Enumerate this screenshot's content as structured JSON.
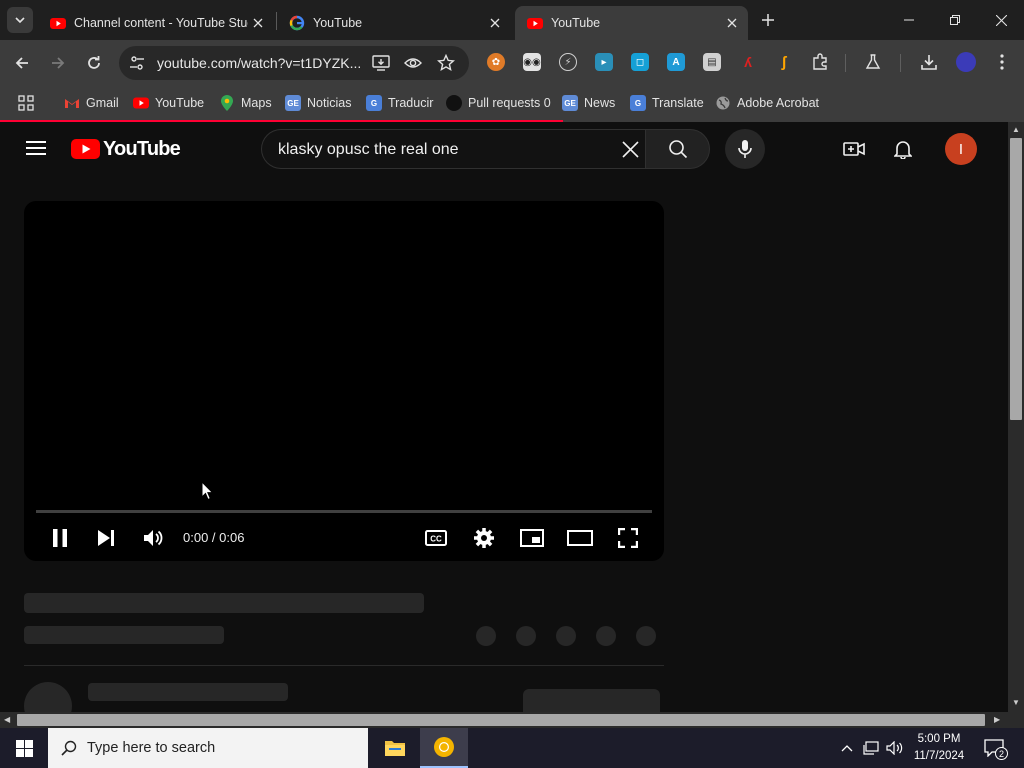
{
  "browser": {
    "tabs": [
      {
        "title": "Channel content - YouTube Studio",
        "icon": "youtube-favicon",
        "active": false
      },
      {
        "title": "YouTube",
        "icon": "google-favicon",
        "active": false
      },
      {
        "title": "YouTube",
        "icon": "youtube-favicon",
        "active": true
      }
    ],
    "url": "youtube.com/watch?v=t1DYZK...",
    "bookmarks": [
      {
        "label": "Gmail",
        "icon": "gmail-icon"
      },
      {
        "label": "YouTube",
        "icon": "youtube-icon"
      },
      {
        "label": "Maps",
        "icon": "maps-icon"
      },
      {
        "label": "Noticias",
        "icon": "google-news-icon"
      },
      {
        "label": "Traducir",
        "icon": "translate-icon"
      },
      {
        "label": "Pull requests 0",
        "icon": "github-icon"
      },
      {
        "label": "News",
        "icon": "google-news-icon"
      },
      {
        "label": "Translate",
        "icon": "translate-icon"
      },
      {
        "label": "Adobe Acrobat",
        "icon": "globe-icon"
      }
    ],
    "load_progress": 0.55
  },
  "youtube": {
    "logo_text": "YouTube",
    "search_query": "klasky opusc the real one",
    "avatar_letter": "I",
    "player": {
      "time": "0:00 / 0:06",
      "progress": 0.0
    }
  },
  "taskbar": {
    "search_placeholder": "Type here to search",
    "time": "5:00 PM",
    "date": "11/7/2024",
    "notification_count": "2"
  },
  "colors": {
    "youtube_red": "#ff0000",
    "page_bg": "#0f0f0f",
    "toolbar_bg": "#3c3c3c",
    "tabstrip_bg": "#1f1f1f",
    "avatar_bg": "#c8401f"
  }
}
